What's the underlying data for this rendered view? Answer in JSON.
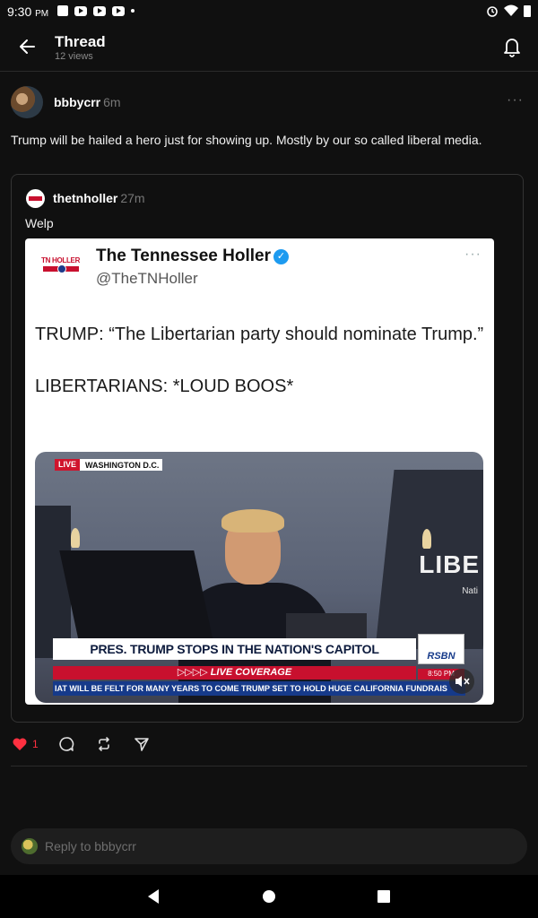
{
  "status_bar": {
    "time": "9:30",
    "ampm": "PM"
  },
  "header": {
    "title": "Thread",
    "views": "12 views"
  },
  "post": {
    "author": "bbbycrr",
    "time": "6m",
    "text": "Trump will be hailed a hero just for showing up. Mostly by our so called liberal media."
  },
  "quoted": {
    "author": "thetnholler",
    "time": "27m",
    "text": "Welp",
    "tweet": {
      "logo_text": "TN HOLLER",
      "display_name": "The Tennessee Holler",
      "handle": "@TheTNHoller",
      "line1": "TRUMP: “The Libertarian party should nominate Trump.”",
      "line2": "LIBERTARIANS: *LOUD BOOS*",
      "video": {
        "live_tag": "LIVE",
        "location": "WASHINGTON D.C.",
        "bg_text": "LIBE",
        "bg_sub": "Nati",
        "headline": "PRES. TRUMP STOPS IN THE NATION'S CAPITOL",
        "coverage": "▷▷▷▷ LIVE COVERAGE",
        "ticker": "IAT WILL BE FELT FOR MANY YEARS TO COME     TRUMP SET TO HOLD HUGE CALIFORNIA FUNDRAIS",
        "network": "RSBN",
        "clock": "8:50 PM"
      }
    }
  },
  "actions": {
    "likes": "1"
  },
  "reply": {
    "placeholder": "Reply to bbbycrr"
  },
  "colors": {
    "like": "#ff3040",
    "verified": "#1d9bf0",
    "live_red": "#c8102e",
    "ticker_blue": "#163a8a"
  }
}
